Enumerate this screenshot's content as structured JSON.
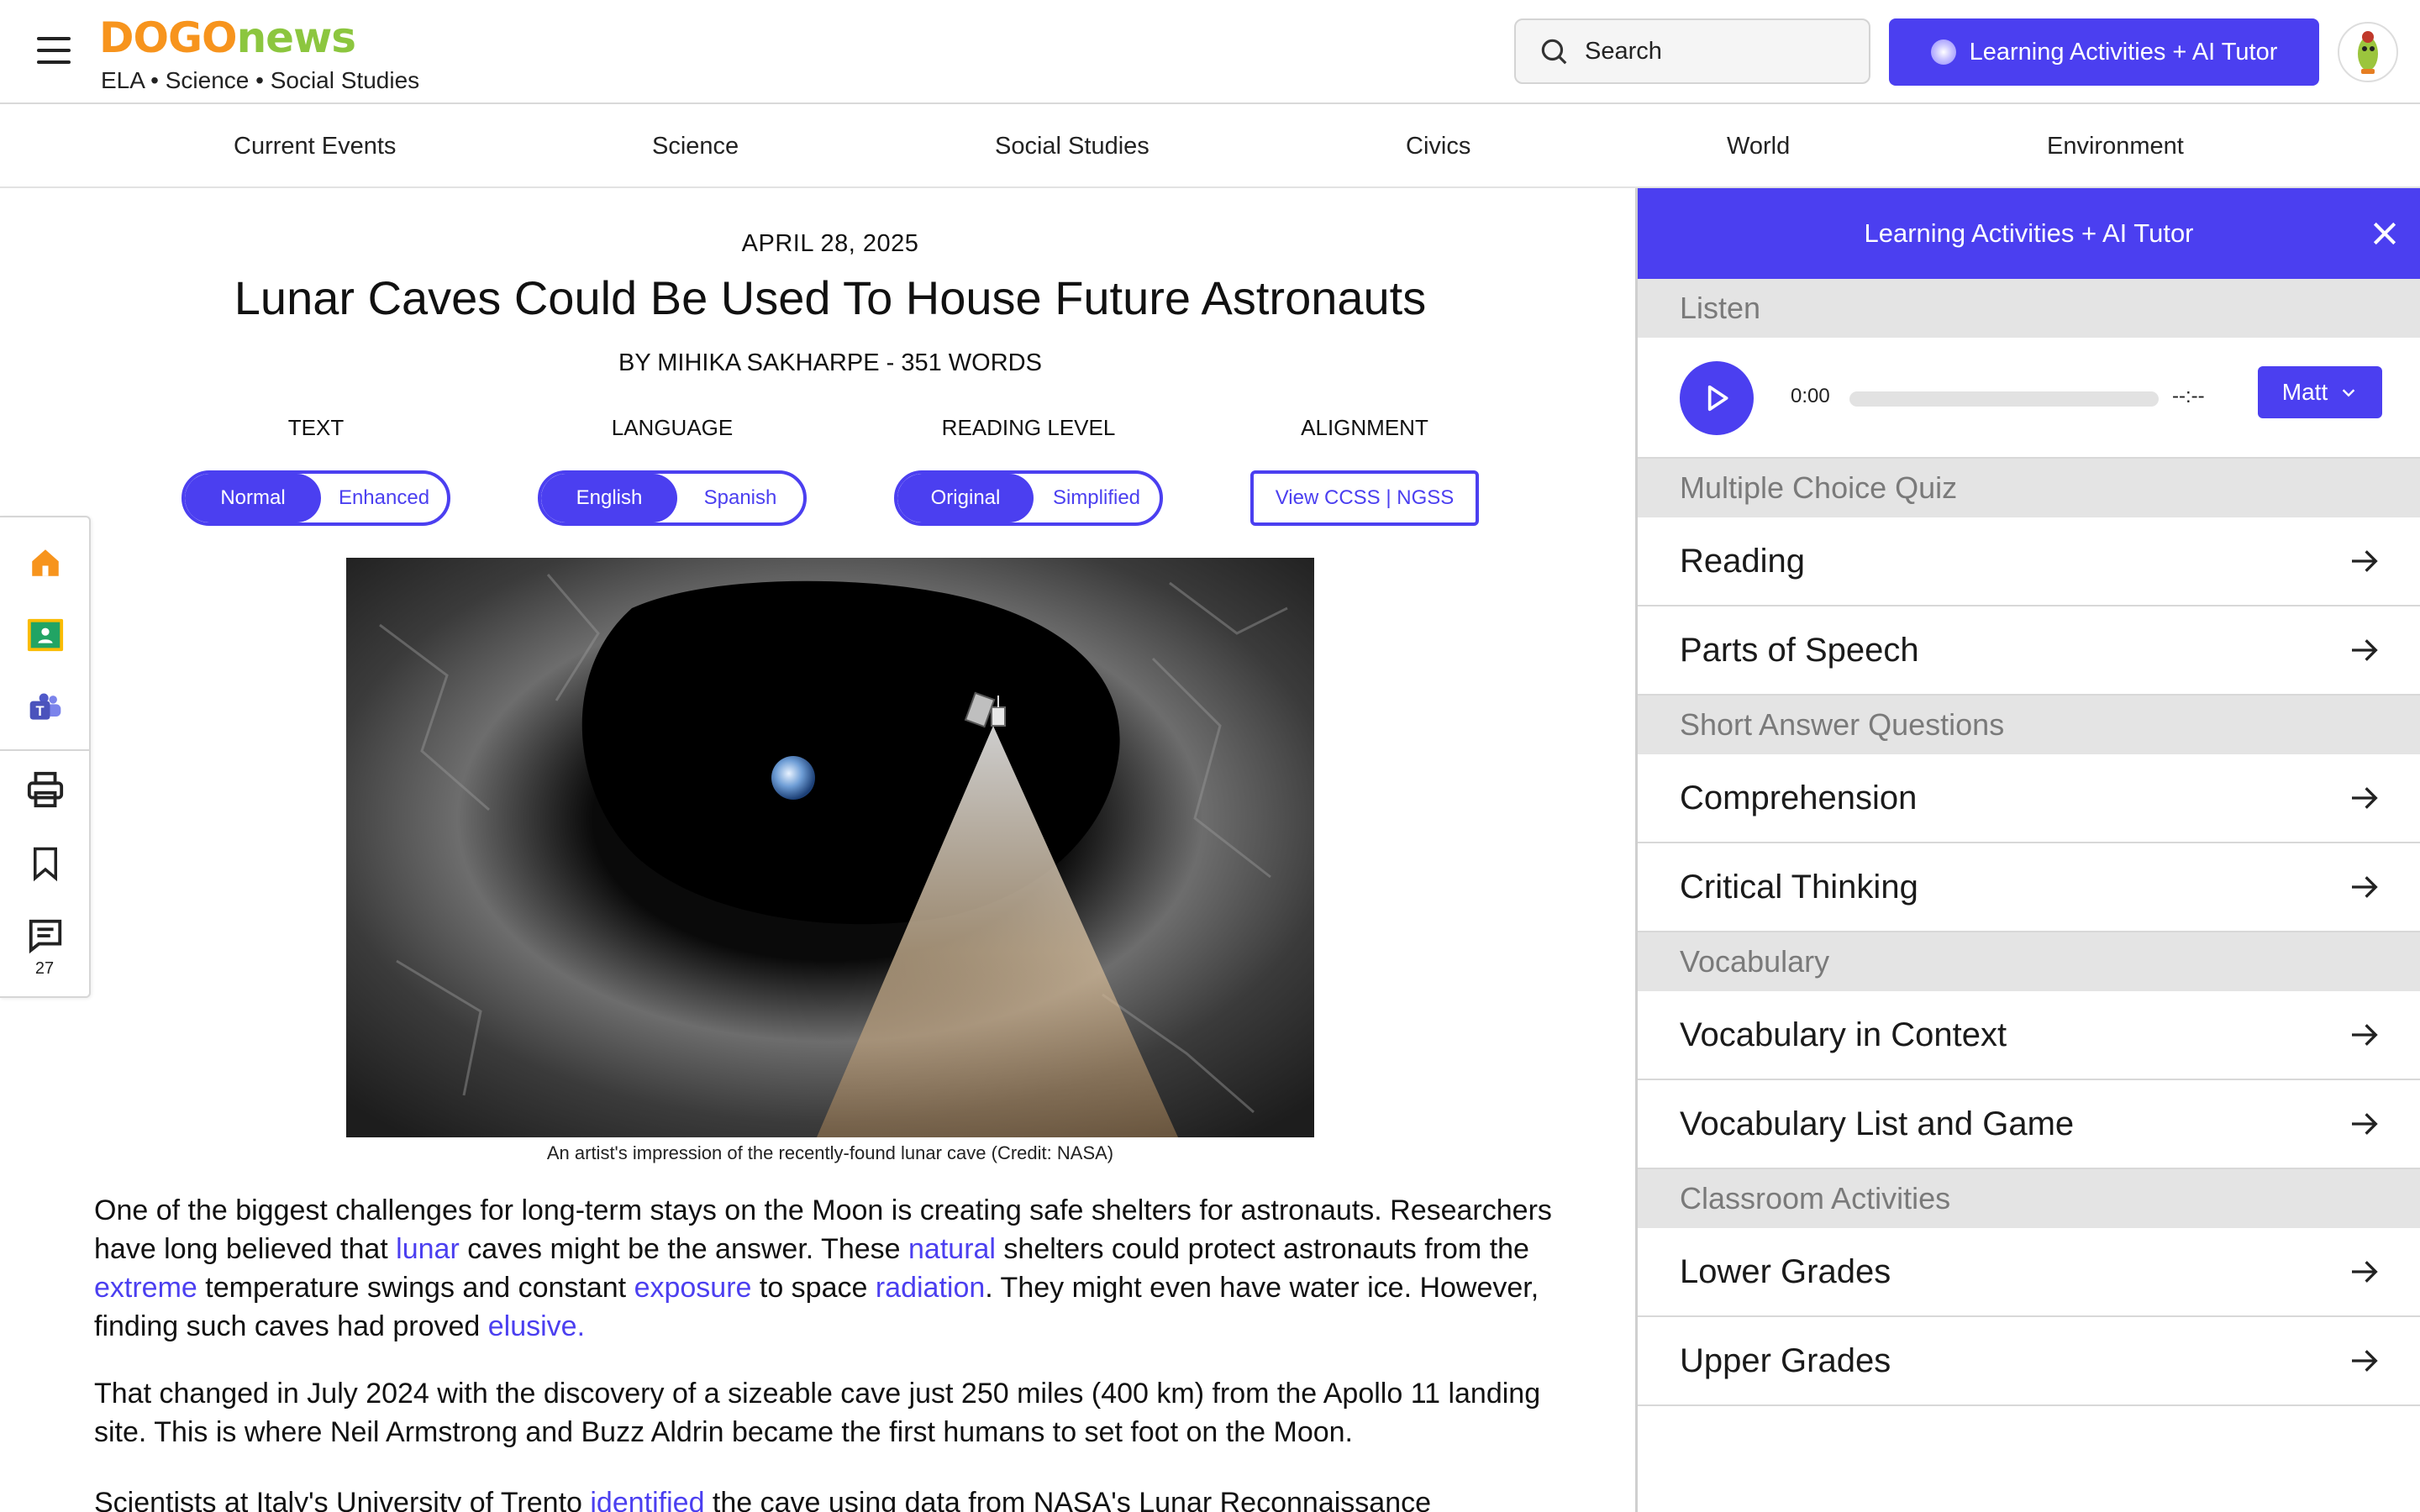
{
  "header": {
    "logo_part1": "DOGO",
    "logo_part2": "news",
    "subjects": "ELA • Science • Social Studies",
    "search_label": "Search",
    "learning_button": "Learning Activities + AI Tutor"
  },
  "categories": [
    "Current Events",
    "Science",
    "Social Studies",
    "Civics",
    "World",
    "Environment"
  ],
  "article": {
    "date": "APRIL 28, 2025",
    "title": "Lunar Caves Could Be Used To House Future Astronauts",
    "byline": "BY MIHIKA SAKHARPE - 351 WORDS",
    "options": {
      "text_label": "TEXT",
      "text_on": "Normal",
      "text_off": "Enhanced",
      "language_label": "LANGUAGE",
      "language_on": "English",
      "language_off": "Spanish",
      "level_label": "READING LEVEL",
      "level_on": "Original",
      "level_off": "Simplified",
      "alignment_label": "ALIGNMENT",
      "alignment_button": "View CCSS | NGSS"
    },
    "caption": "An artist's impression of the recently-found lunar cave (Credit: NASA)",
    "p1": {
      "t1": "One of the biggest challenges for long-term stays on the Moon is creating safe shelters for astronauts. Researchers have long believed that ",
      "l1": "lunar",
      "t2": " caves might be the answer. These ",
      "l2": "natural",
      "t3": " shelters could protect astronauts from the ",
      "l3": "extreme",
      "t4": " temperature swings and constant ",
      "l4": "exposure",
      "t5": " to space ",
      "l5": "radiation",
      "t6": ". They might even have water ice. However, finding such caves had proved ",
      "l6": "elusive."
    },
    "p2": "That changed in July 2024 with the discovery of a sizeable cave just 250 miles (400 km) from the Apollo 11 landing site. This is where Neil Armstrong and Buzz Aldrin became the first humans to set foot on the Moon.",
    "p3": {
      "t1": "Scientists at Italy's University of Trento ",
      "l1": "identified",
      "t2": " the cave using data from NASA's Lunar Reconnaissance"
    }
  },
  "rail": {
    "comment_count": "27"
  },
  "panel": {
    "title": "Learning Activities + AI Tutor",
    "listen": {
      "section": "Listen",
      "time_now": "0:00",
      "time_end": "--:--",
      "voice": "Matt"
    },
    "quiz_section": "Multiple Choice Quiz",
    "quiz_items": [
      "Reading",
      "Parts of Speech"
    ],
    "short_section": "Short Answer Questions",
    "short_items": [
      "Comprehension",
      "Critical Thinking"
    ],
    "vocab_section": "Vocabulary",
    "vocab_items": [
      "Vocabulary in Context",
      "Vocabulary List and Game"
    ],
    "class_section": "Classroom Activities",
    "class_items": [
      "Lower Grades",
      "Upper Grades"
    ]
  },
  "colors": {
    "accent": "#4b3ff0",
    "logo_orange": "#f7941d",
    "logo_green": "#8cc63f",
    "section_bg": "#e4e4e4"
  }
}
